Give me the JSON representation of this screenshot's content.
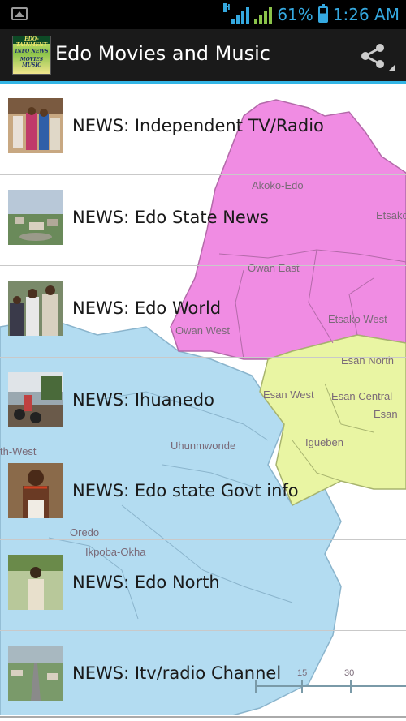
{
  "status_bar": {
    "network_type": "H",
    "battery_percent": "61%",
    "time": "1:26 AM",
    "icons": [
      "picture-notification-icon",
      "mobile-signal-icon",
      "signal-strength-icon",
      "battery-icon"
    ]
  },
  "action_bar": {
    "title": "Edo Movies and Music",
    "logo_lines": [
      "EDO-TAINMENT",
      "INFO NEWS",
      "MOVIES MUSIC"
    ],
    "share_icon": "share-icon"
  },
  "map_labels": [
    "Akoko-Edo",
    "Etsako",
    "Owan East",
    "Etsako West",
    "Owan West",
    "Esan North",
    "Esan West",
    "Esan Central",
    "Esan",
    "Uhunmwonde",
    "Igueben",
    "Oredo",
    "Ikpoba-Okha",
    "th-West",
    "15",
    "30"
  ],
  "items": [
    {
      "label": "NEWS: Independent TV/Radio",
      "thumb": "dignitaries-photo"
    },
    {
      "label": "NEWS: Edo State News",
      "thumb": "city-aerial-photo"
    },
    {
      "label": "NEWS: Edo World",
      "thumb": "group-people-photo"
    },
    {
      "label": "NEWS: Ihuanedo",
      "thumb": "street-motorcycles-photo"
    },
    {
      "label": "NEWS: Edo state Govt info",
      "thumb": "traditional-chief-photo"
    },
    {
      "label": "NEWS: Edo North",
      "thumb": "man-in-field-photo"
    },
    {
      "label": "NEWS: Itv/radio Channel",
      "thumb": "road-aerial-photo"
    }
  ],
  "colors": {
    "accent": "#33b5e5",
    "status_text": "#35a9e0",
    "map_pink": "#f08ce3",
    "map_blue": "#b3dcf1",
    "map_yellow": "#e9f5a3"
  }
}
